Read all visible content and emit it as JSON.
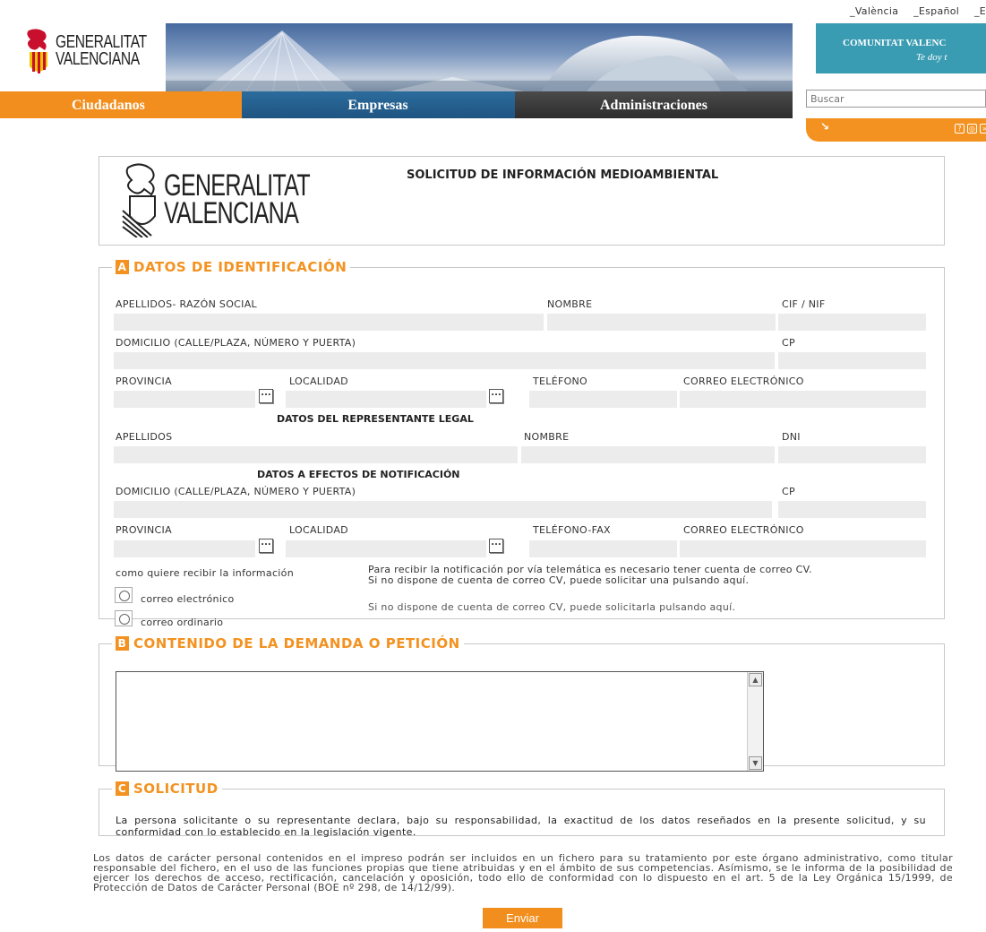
{
  "lang": [
    "_València",
    "_Español",
    "_E"
  ],
  "header": {
    "logo_line1": "GENERALITAT",
    "logo_line2": "VALENCIANA",
    "cv_title": "COMUNITAT VALENC",
    "cv_slogan": "Te doy t"
  },
  "nav": {
    "ciudadanos": "Ciudadanos",
    "empresas": "Empresas",
    "administraciones": "Administraciones"
  },
  "search": {
    "placeholder": "Buscar",
    "go": "↘"
  },
  "colors": {
    "orange": "#f39220",
    "blue": "#1f5482",
    "dark": "#2d2d2d",
    "field": "#ececec"
  },
  "form": {
    "title": "SOLICITUD DE INFORMACIÓN MEDIOAMBIENTAL",
    "sectionA": {
      "letter": "A",
      "title": "DATOS DE IDENTIFICACIÓN",
      "apellidos_razon": "APELLIDOS- RAZÓN SOCIAL",
      "nombre": "NOMBRE",
      "cif": "CIF / NIF",
      "domicilio": "DOMICILIO (CALLE/PLAZA, NÚMERO Y PUERTA)",
      "cp": "CP",
      "provincia": "PROVINCIA",
      "localidad": "LOCALIDAD",
      "telefono": "TELÉFONO",
      "correo": "CORREO ELECTRÓNICO",
      "rep_title": "DATOS DEL REPRESENTANTE LEGAL",
      "apellidos": "APELLIDOS",
      "nombre2": "NOMBRE",
      "dni": "DNI",
      "notif_title": "DATOS A EFECTOS DE NOTIFICACIÓN",
      "domicilio2": "DOMICILIO (CALLE/PLAZA, NÚMERO Y PUERTA)",
      "cp2": "CP",
      "provincia2": "PROVINCIA",
      "localidad2": "LOCALIDAD",
      "telefono_fax": "TELÉFONO-FAX",
      "correo2": "CORREO ELECTRÓNICO",
      "browse": "...",
      "receive_label": "como quiere recibir la información",
      "option_email": "correo electrónico",
      "option_post": "correo ordinario",
      "note1": "Para recibir la notificación por vía telemática es necesario tener cuenta de correo CV. Si no dispone de cuenta de correo CV, puede solicitar una pulsando aquí.",
      "note2": "Si no dispone de cuenta de correo CV, puede solicitarla pulsando aquí."
    },
    "sectionB": {
      "letter": "B",
      "title": "CONTENIDO DE LA DEMANDA O PETICIÓN",
      "scroll_up": "▲",
      "scroll_down": "▼"
    },
    "sectionC": {
      "letter": "C",
      "title": "SOLICITUD",
      "text": "La persona solicitante o su representante declara, bajo su responsabilidad, la exactitud de los datos reseñados en la presente solicitud, y su conformidad con lo establecido en la legislación vigente."
    },
    "privacy": "Los datos de carácter personal contenidos en el impreso podrán ser incluidos en un fichero para su tratamiento por este órgano administrativo, como titular responsable del fichero, en el uso de las funciones propias que tiene atribuidas y en el ámbito de sus competencias. Asímismo, se le informa de la posibilidad de ejercer los derechos de acceso, rectificación, cancelación y oposición, todo ello de conformidad con lo dispuesto en el art. 5 de la Ley Orgánica 15/1999, de Protección de Datos de Carácter Personal (BOE nº 298, de 14/12/99).",
    "submit": "Enviar"
  }
}
